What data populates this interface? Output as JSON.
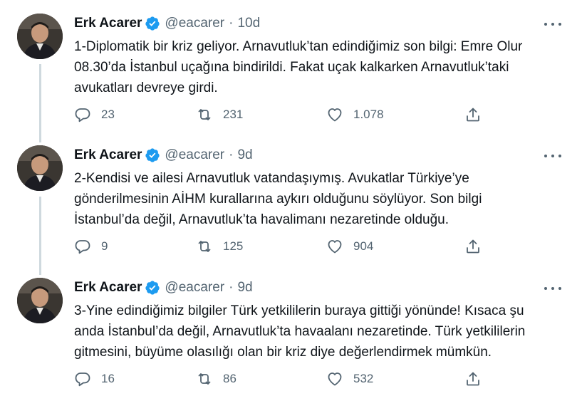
{
  "tweets": [
    {
      "name": "Erk Acarer",
      "handle": "@eacarer",
      "separator": "·",
      "time": "10d",
      "text": "1-Diplomatik bir kriz geliyor. Arnavutluk’tan edindiğimiz son bilgi: Emre Olur\n08.30’da İstanbul uçağına bindirildi. Fakat uçak kalkarken Arnavutluk’taki\navukatları devreye girdi.",
      "replies": "23",
      "retweets": "231",
      "likes": "1.078"
    },
    {
      "name": "Erk Acarer",
      "handle": "@eacarer",
      "separator": "·",
      "time": "9d",
      "text": "2-Kendisi ve ailesi Arnavutluk vatandaşıymış. Avukatlar Türkiye’ye\ngönderilmesinin AİHM kurallarına aykırı olduğunu söylüyor. Son bilgi\nİstanbul’da değil, Arnavutluk’ta havalimanı nezaretinde olduğu.",
      "replies": "9",
      "retweets": "125",
      "likes": "904"
    },
    {
      "name": "Erk Acarer",
      "handle": "@eacarer",
      "separator": "·",
      "time": "9d",
      "text": "3-Yine edindiğimiz bilgiler Türk yetkililerin buraya gittiği yönünde! Kısaca şu\nanda İstanbul’da değil, Arnavutluk’ta havaalanı nezaretinde. Türk yetkililerin\ngitmesini, büyüme olasılığı olan bir kriz diye değerlendirmek mümkün.",
      "replies": "16",
      "retweets": "86",
      "likes": "532"
    }
  ],
  "icons": {
    "verified": "verified-badge-icon",
    "more": "more-options-icon",
    "reply": "reply-icon",
    "retweet": "retweet-icon",
    "like": "like-icon",
    "share": "share-icon"
  },
  "colors": {
    "text": "#0f1419",
    "secondary": "#536471",
    "verified": "#1d9bf0",
    "thread_line": "#cfd9de"
  }
}
